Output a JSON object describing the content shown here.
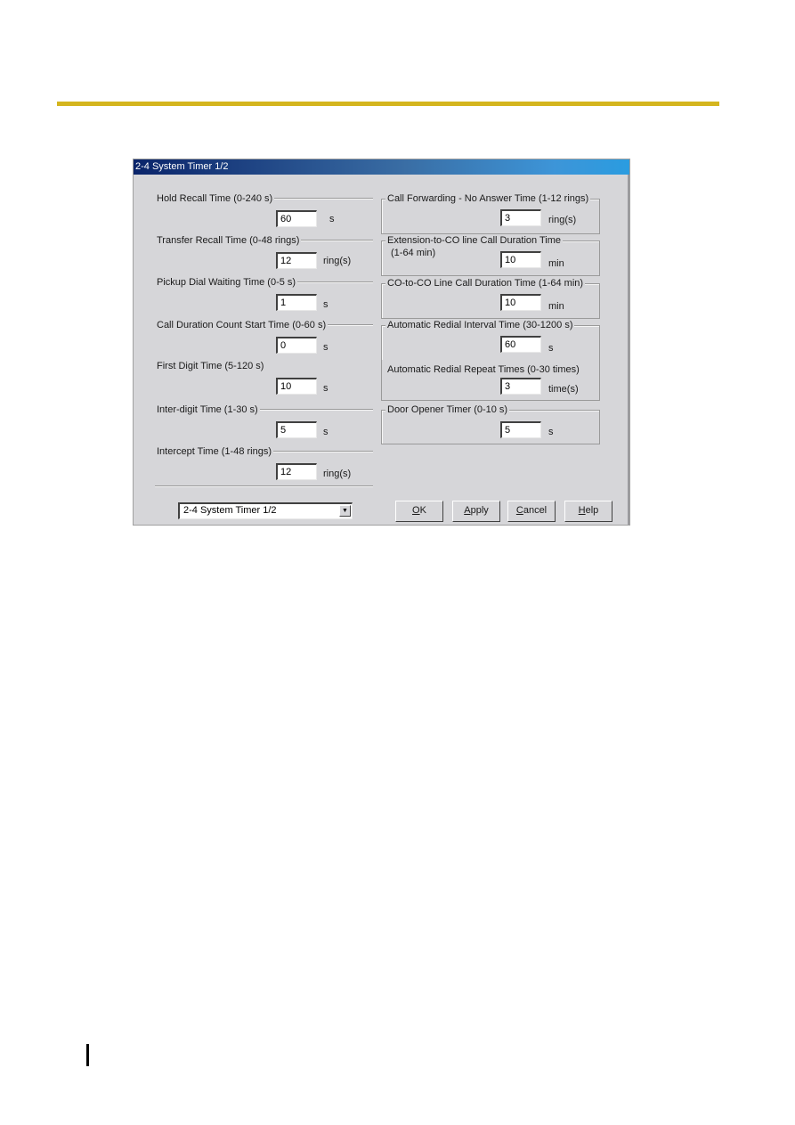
{
  "page": {
    "accent_rule_color": "#d4b51e"
  },
  "dialog": {
    "title": "2-4 System Timer 1/2",
    "left_groups": [
      {
        "label": "Hold Recall Time (0-240 s)",
        "value": "60",
        "unit": "s"
      },
      {
        "label": "Transfer Recall Time (0-48 rings)",
        "value": "12",
        "unit": "ring(s)"
      },
      {
        "label": "Pickup Dial Waiting Time (0-5 s)",
        "value": "1",
        "unit": "s"
      },
      {
        "label": "Call Duration Count Start Time (0-60 s)",
        "value": "0",
        "unit": "s"
      },
      {
        "label": "First Digit Time (5-120 s)",
        "value": "10",
        "unit": "s"
      },
      {
        "label": "Inter-digit Time (1-30 s)",
        "value": "5",
        "unit": "s"
      },
      {
        "label": "Intercept Time (1-48 rings)",
        "value": "12",
        "unit": "ring(s)"
      }
    ],
    "right_groups": [
      {
        "label": "Call Forwarding - No Answer Time (1-12 rings)",
        "sublabel": "",
        "value": "3",
        "unit": "ring(s)"
      },
      {
        "label": "Extension-to-CO line Call Duration Time",
        "sublabel": "(1-64 min)",
        "value": "10",
        "unit": "min"
      },
      {
        "label": "CO-to-CO Line Call Duration Time (1-64 min)",
        "sublabel": "",
        "value": "10",
        "unit": "min"
      },
      {
        "label": "Automatic Redial Interval Time (30-1200 s)",
        "sublabel": "",
        "value": "60",
        "unit": "s"
      },
      {
        "label": "Automatic Redial Repeat Times (0-30 times)",
        "sublabel": "",
        "value": "3",
        "unit": "time(s)"
      },
      {
        "label": "Door Opener Timer (0-10 s)",
        "sublabel": "",
        "value": "5",
        "unit": "s"
      }
    ],
    "page_selector": {
      "selected": "2-4 System Timer 1/2"
    },
    "buttons": {
      "ok": {
        "mnemonic": "O",
        "rest": "K"
      },
      "apply": {
        "mnemonic": "A",
        "rest": "pply"
      },
      "cancel": {
        "mnemonic": "C",
        "rest": "ancel"
      },
      "help": {
        "mnemonic": "H",
        "rest": "elp"
      }
    }
  }
}
